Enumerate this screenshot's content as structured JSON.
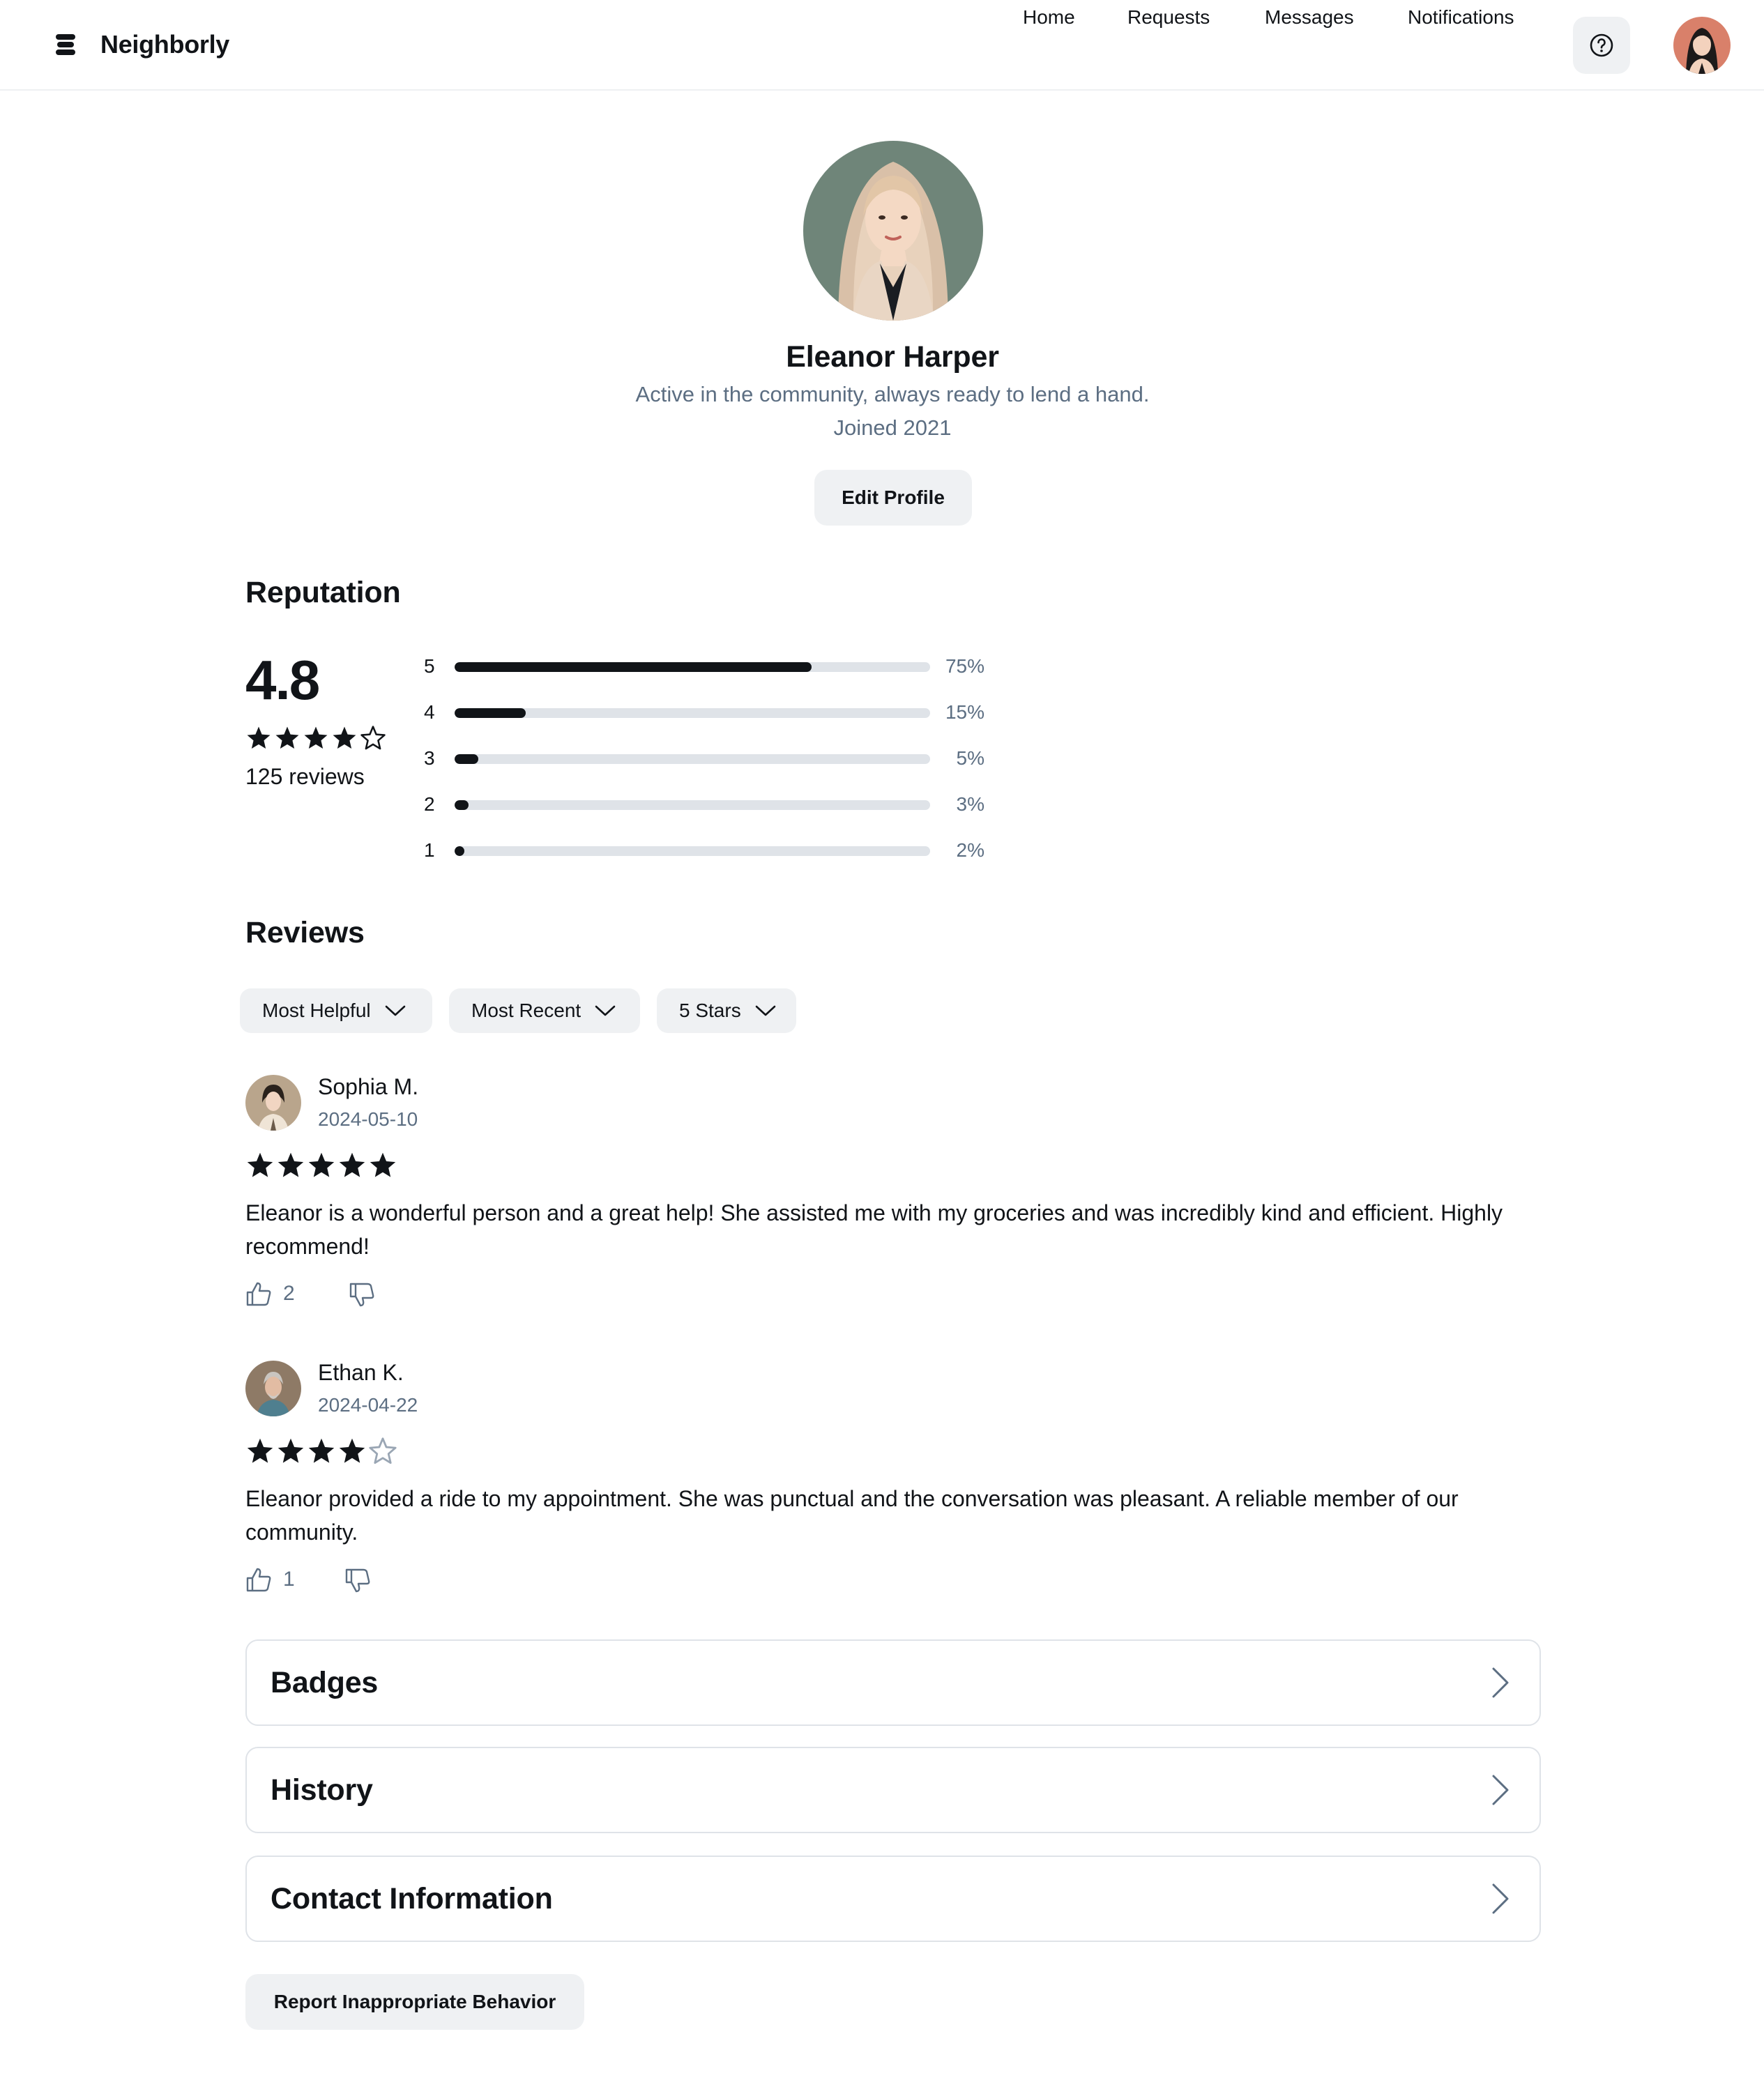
{
  "app": {
    "name": "Neighborly"
  },
  "nav": {
    "links": [
      "Home",
      "Requests",
      "Messages",
      "Notifications"
    ],
    "help_icon": "help-circle-icon"
  },
  "profile": {
    "name": "Eleanor Harper",
    "bio": "Active in the community, always ready to lend a hand.",
    "joined": "Joined 2021",
    "edit_label": "Edit Profile"
  },
  "reputation": {
    "title": "Reputation",
    "average": "4.8",
    "average_stars": 4,
    "review_count": "125 reviews",
    "distribution": [
      {
        "stars": "5",
        "percent": 75,
        "label": "75%"
      },
      {
        "stars": "4",
        "percent": 15,
        "label": "15%"
      },
      {
        "stars": "3",
        "percent": 5,
        "label": "5%"
      },
      {
        "stars": "2",
        "percent": 3,
        "label": "3%"
      },
      {
        "stars": "1",
        "percent": 2,
        "label": "2%"
      }
    ]
  },
  "reviews": {
    "title": "Reviews",
    "filters": [
      "Most Helpful",
      "Most Recent",
      "5 Stars"
    ],
    "items": [
      {
        "author": "Sophia M.",
        "date": "2024-05-10",
        "rating": 5,
        "text": "Eleanor is a wonderful person and a great help! She assisted me with my groceries and was incredibly kind and efficient. Highly recommend!",
        "likes": "2"
      },
      {
        "author": "Ethan K.",
        "date": "2024-04-22",
        "rating": 4,
        "text": "Eleanor provided a ride to my appointment. She was punctual and the conversation was pleasant. A reliable member of our community.",
        "likes": "1"
      }
    ]
  },
  "sections": [
    "Badges",
    "History",
    "Contact Information"
  ],
  "report_label": "Report Inappropriate Behavior",
  "colors": {
    "text": "#111418",
    "muted": "#5c6e82",
    "chip_bg": "#eff1f3",
    "bar_track": "#dfe3e8"
  }
}
